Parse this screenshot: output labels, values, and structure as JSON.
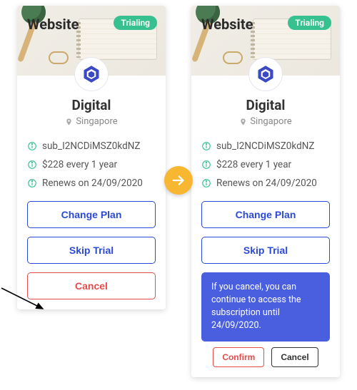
{
  "cardA": {
    "title": "Website",
    "badge": "Trialing",
    "plan_name": "Digital",
    "location": "Singapore",
    "info": {
      "sub_id": "sub_I2NCDiMSZ0kdNZ",
      "price": "$228 every 1 year",
      "renew": "Renews on 24/09/2020"
    },
    "actions": {
      "change_plan": "Change Plan",
      "skip_trial": "Skip Trial",
      "cancel": "Cancel"
    }
  },
  "cardB": {
    "title": "Website",
    "badge": "Trialing",
    "plan_name": "Digital",
    "location": "Singapore",
    "info": {
      "sub_id": "sub_I2NCDiMSZ0kdNZ",
      "price": "$228 every 1 year",
      "renew": "Renews on 24/09/2020"
    },
    "actions": {
      "change_plan": "Change Plan",
      "skip_trial": "Skip Trial"
    },
    "confirm": {
      "message": "If you cancel, you can continue to access the subscription until 24/09/2020.",
      "confirm_label": "Confirm",
      "cancel_label": "Cancel"
    }
  },
  "colors": {
    "primary": "#2a49d8",
    "danger": "#e44b4b",
    "badge": "#37c190",
    "transition": "#f7b731",
    "confirm_bg": "#4a5fe0"
  }
}
